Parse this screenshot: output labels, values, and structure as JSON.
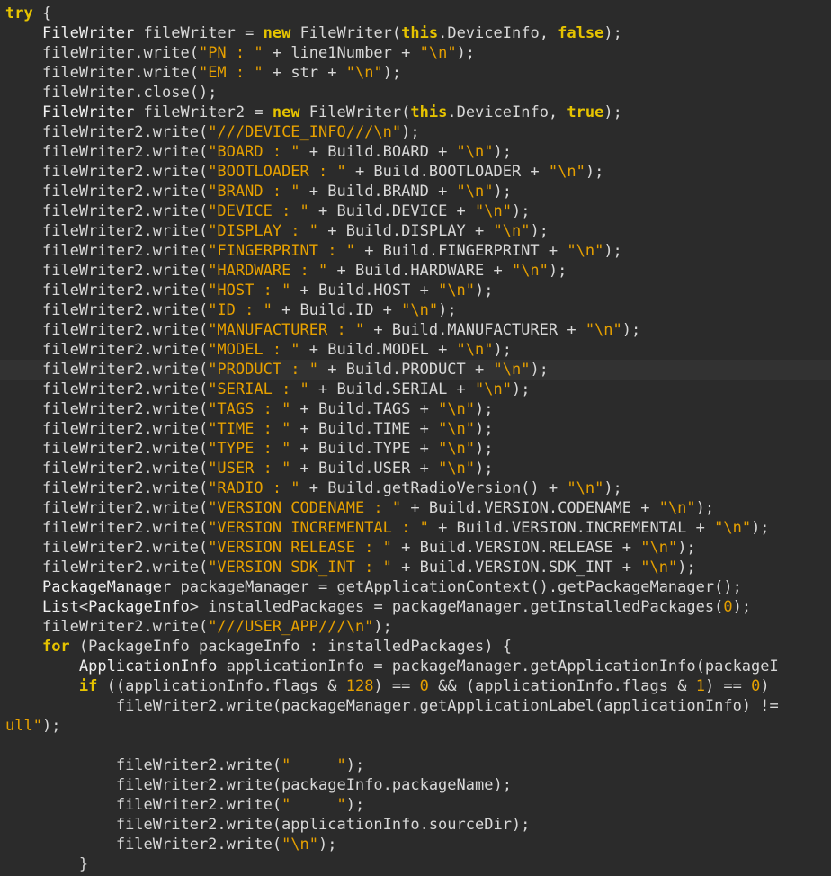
{
  "editor": {
    "language": "java",
    "colors": {
      "background": "#2b2b2b",
      "keyword": "#e6c300",
      "string": "#e6a000",
      "text": "#d8d8d8",
      "current_line": "#323232"
    },
    "current_line_index": 18,
    "lines": [
      {
        "indent": "",
        "tokens": [
          [
            "kw",
            "try"
          ],
          [
            "plain",
            " {"
          ]
        ]
      },
      {
        "indent": "    ",
        "tokens": [
          [
            "type",
            "FileWriter"
          ],
          [
            "plain",
            " fileWriter = "
          ],
          [
            "kw",
            "new"
          ],
          [
            "plain",
            " FileWriter("
          ],
          [
            "this",
            "this"
          ],
          [
            "plain",
            ".DeviceInfo, "
          ],
          [
            "kw",
            "false"
          ],
          [
            "plain",
            ");"
          ]
        ]
      },
      {
        "indent": "    ",
        "tokens": [
          [
            "plain",
            "fileWriter.write("
          ],
          [
            "str",
            "\"PN : \""
          ],
          [
            "plain",
            " + line1Number + "
          ],
          [
            "str",
            "\"\\n\""
          ],
          [
            "plain",
            ");"
          ]
        ]
      },
      {
        "indent": "    ",
        "tokens": [
          [
            "plain",
            "fileWriter.write("
          ],
          [
            "str",
            "\"EM : \""
          ],
          [
            "plain",
            " + str + "
          ],
          [
            "str",
            "\"\\n\""
          ],
          [
            "plain",
            ");"
          ]
        ]
      },
      {
        "indent": "    ",
        "tokens": [
          [
            "plain",
            "fileWriter.close();"
          ]
        ]
      },
      {
        "indent": "    ",
        "tokens": [
          [
            "type",
            "FileWriter"
          ],
          [
            "plain",
            " fileWriter2 = "
          ],
          [
            "kw",
            "new"
          ],
          [
            "plain",
            " FileWriter("
          ],
          [
            "this",
            "this"
          ],
          [
            "plain",
            ".DeviceInfo, "
          ],
          [
            "kw",
            "true"
          ],
          [
            "plain",
            ");"
          ]
        ]
      },
      {
        "indent": "    ",
        "tokens": [
          [
            "plain",
            "fileWriter2.write("
          ],
          [
            "str",
            "\"///DEVICE_INFO///\\n\""
          ],
          [
            "plain",
            ");"
          ]
        ]
      },
      {
        "indent": "    ",
        "tokens": [
          [
            "plain",
            "fileWriter2.write("
          ],
          [
            "str",
            "\"BOARD : \""
          ],
          [
            "plain",
            " + Build.BOARD + "
          ],
          [
            "str",
            "\"\\n\""
          ],
          [
            "plain",
            ");"
          ]
        ]
      },
      {
        "indent": "    ",
        "tokens": [
          [
            "plain",
            "fileWriter2.write("
          ],
          [
            "str",
            "\"BOOTLOADER : \""
          ],
          [
            "plain",
            " + Build.BOOTLOADER + "
          ],
          [
            "str",
            "\"\\n\""
          ],
          [
            "plain",
            ");"
          ]
        ]
      },
      {
        "indent": "    ",
        "tokens": [
          [
            "plain",
            "fileWriter2.write("
          ],
          [
            "str",
            "\"BRAND : \""
          ],
          [
            "plain",
            " + Build.BRAND + "
          ],
          [
            "str",
            "\"\\n\""
          ],
          [
            "plain",
            ");"
          ]
        ]
      },
      {
        "indent": "    ",
        "tokens": [
          [
            "plain",
            "fileWriter2.write("
          ],
          [
            "str",
            "\"DEVICE : \""
          ],
          [
            "plain",
            " + Build.DEVICE + "
          ],
          [
            "str",
            "\"\\n\""
          ],
          [
            "plain",
            ");"
          ]
        ]
      },
      {
        "indent": "    ",
        "tokens": [
          [
            "plain",
            "fileWriter2.write("
          ],
          [
            "str",
            "\"DISPLAY : \""
          ],
          [
            "plain",
            " + Build.DISPLAY + "
          ],
          [
            "str",
            "\"\\n\""
          ],
          [
            "plain",
            ");"
          ]
        ]
      },
      {
        "indent": "    ",
        "tokens": [
          [
            "plain",
            "fileWriter2.write("
          ],
          [
            "str",
            "\"FINGERPRINT : \""
          ],
          [
            "plain",
            " + Build.FINGERPRINT + "
          ],
          [
            "str",
            "\"\\n\""
          ],
          [
            "plain",
            ");"
          ]
        ]
      },
      {
        "indent": "    ",
        "tokens": [
          [
            "plain",
            "fileWriter2.write("
          ],
          [
            "str",
            "\"HARDWARE : \""
          ],
          [
            "plain",
            " + Build.HARDWARE + "
          ],
          [
            "str",
            "\"\\n\""
          ],
          [
            "plain",
            ");"
          ]
        ]
      },
      {
        "indent": "    ",
        "tokens": [
          [
            "plain",
            "fileWriter2.write("
          ],
          [
            "str",
            "\"HOST : \""
          ],
          [
            "plain",
            " + Build.HOST + "
          ],
          [
            "str",
            "\"\\n\""
          ],
          [
            "plain",
            ");"
          ]
        ]
      },
      {
        "indent": "    ",
        "tokens": [
          [
            "plain",
            "fileWriter2.write("
          ],
          [
            "str",
            "\"ID : \""
          ],
          [
            "plain",
            " + Build.ID + "
          ],
          [
            "str",
            "\"\\n\""
          ],
          [
            "plain",
            ");"
          ]
        ]
      },
      {
        "indent": "    ",
        "tokens": [
          [
            "plain",
            "fileWriter2.write("
          ],
          [
            "str",
            "\"MANUFACTURER : \""
          ],
          [
            "plain",
            " + Build.MANUFACTURER + "
          ],
          [
            "str",
            "\"\\n\""
          ],
          [
            "plain",
            ");"
          ]
        ]
      },
      {
        "indent": "    ",
        "tokens": [
          [
            "plain",
            "fileWriter2.write("
          ],
          [
            "str",
            "\"MODEL : \""
          ],
          [
            "plain",
            " + Build.MODEL + "
          ],
          [
            "str",
            "\"\\n\""
          ],
          [
            "plain",
            ");"
          ]
        ]
      },
      {
        "indent": "    ",
        "tokens": [
          [
            "plain",
            "fileWriter2.write("
          ],
          [
            "str",
            "\"PRODUCT : \""
          ],
          [
            "plain",
            " + Build.PRODUCT + "
          ],
          [
            "str",
            "\"\\n\""
          ],
          [
            "plain",
            ");"
          ]
        ]
      },
      {
        "indent": "    ",
        "tokens": [
          [
            "plain",
            "fileWriter2.write("
          ],
          [
            "str",
            "\"SERIAL : \""
          ],
          [
            "plain",
            " + Build.SERIAL + "
          ],
          [
            "str",
            "\"\\n\""
          ],
          [
            "plain",
            ");"
          ]
        ]
      },
      {
        "indent": "    ",
        "tokens": [
          [
            "plain",
            "fileWriter2.write("
          ],
          [
            "str",
            "\"TAGS : \""
          ],
          [
            "plain",
            " + Build.TAGS + "
          ],
          [
            "str",
            "\"\\n\""
          ],
          [
            "plain",
            ");"
          ]
        ]
      },
      {
        "indent": "    ",
        "tokens": [
          [
            "plain",
            "fileWriter2.write("
          ],
          [
            "str",
            "\"TIME : \""
          ],
          [
            "plain",
            " + Build.TIME + "
          ],
          [
            "str",
            "\"\\n\""
          ],
          [
            "plain",
            ");"
          ]
        ]
      },
      {
        "indent": "    ",
        "tokens": [
          [
            "plain",
            "fileWriter2.write("
          ],
          [
            "str",
            "\"TYPE : \""
          ],
          [
            "plain",
            " + Build.TYPE + "
          ],
          [
            "str",
            "\"\\n\""
          ],
          [
            "plain",
            ");"
          ]
        ]
      },
      {
        "indent": "    ",
        "tokens": [
          [
            "plain",
            "fileWriter2.write("
          ],
          [
            "str",
            "\"USER : \""
          ],
          [
            "plain",
            " + Build.USER + "
          ],
          [
            "str",
            "\"\\n\""
          ],
          [
            "plain",
            ");"
          ]
        ]
      },
      {
        "indent": "    ",
        "tokens": [
          [
            "plain",
            "fileWriter2.write("
          ],
          [
            "str",
            "\"RADIO : \""
          ],
          [
            "plain",
            " + Build.getRadioVersion() + "
          ],
          [
            "str",
            "\"\\n\""
          ],
          [
            "plain",
            ");"
          ]
        ]
      },
      {
        "indent": "    ",
        "tokens": [
          [
            "plain",
            "fileWriter2.write("
          ],
          [
            "str",
            "\"VERSION CODENAME : \""
          ],
          [
            "plain",
            " + Build.VERSION.CODENAME + "
          ],
          [
            "str",
            "\"\\n\""
          ],
          [
            "plain",
            ");"
          ]
        ]
      },
      {
        "indent": "    ",
        "tokens": [
          [
            "plain",
            "fileWriter2.write("
          ],
          [
            "str",
            "\"VERSION INCREMENTAL : \""
          ],
          [
            "plain",
            " + Build.VERSION.INCREMENTAL + "
          ],
          [
            "str",
            "\"\\n\""
          ],
          [
            "plain",
            ");"
          ]
        ]
      },
      {
        "indent": "    ",
        "tokens": [
          [
            "plain",
            "fileWriter2.write("
          ],
          [
            "str",
            "\"VERSION RELEASE : \""
          ],
          [
            "plain",
            " + Build.VERSION.RELEASE + "
          ],
          [
            "str",
            "\"\\n\""
          ],
          [
            "plain",
            ");"
          ]
        ]
      },
      {
        "indent": "    ",
        "tokens": [
          [
            "plain",
            "fileWriter2.write("
          ],
          [
            "str",
            "\"VERSION SDK_INT : \""
          ],
          [
            "plain",
            " + Build.VERSION.SDK_INT + "
          ],
          [
            "str",
            "\"\\n\""
          ],
          [
            "plain",
            ");"
          ]
        ]
      },
      {
        "indent": "    ",
        "tokens": [
          [
            "type",
            "PackageManager"
          ],
          [
            "plain",
            " packageManager = getApplicationContext().getPackageManager();"
          ]
        ]
      },
      {
        "indent": "    ",
        "tokens": [
          [
            "type",
            "List"
          ],
          [
            "plain",
            "<"
          ],
          [
            "type",
            "PackageInfo"
          ],
          [
            "plain",
            "> installedPackages = packageManager.getInstalledPackages("
          ],
          [
            "num",
            "0"
          ],
          [
            "plain",
            ");"
          ]
        ]
      },
      {
        "indent": "    ",
        "tokens": [
          [
            "plain",
            "fileWriter2.write("
          ],
          [
            "str",
            "\"///USER_APP///\\n\""
          ],
          [
            "plain",
            ");"
          ]
        ]
      },
      {
        "indent": "    ",
        "tokens": [
          [
            "kw",
            "for"
          ],
          [
            "plain",
            " (PackageInfo packageInfo : installedPackages) {"
          ]
        ]
      },
      {
        "indent": "        ",
        "tokens": [
          [
            "type",
            "ApplicationInfo"
          ],
          [
            "plain",
            " applicationInfo = packageManager.getApplicationInfo(packageI"
          ]
        ]
      },
      {
        "indent": "        ",
        "tokens": [
          [
            "kw",
            "if"
          ],
          [
            "plain",
            " ((applicationInfo.flags & "
          ],
          [
            "num",
            "128"
          ],
          [
            "plain",
            ") == "
          ],
          [
            "num",
            "0"
          ],
          [
            "plain",
            " && (applicationInfo.flags & "
          ],
          [
            "num",
            "1"
          ],
          [
            "plain",
            ") == "
          ],
          [
            "num",
            "0"
          ],
          [
            "plain",
            ")"
          ]
        ]
      },
      {
        "indent": "            ",
        "tokens": [
          [
            "plain",
            "fileWriter2.write(packageManager.getApplicationLabel(applicationInfo) !="
          ]
        ]
      },
      {
        "indent": "",
        "tokens": [
          [
            "str",
            "ull\""
          ],
          [
            "plain",
            ");"
          ]
        ]
      },
      {
        "indent": "",
        "tokens": []
      },
      {
        "indent": "            ",
        "tokens": [
          [
            "plain",
            "fileWriter2.write("
          ],
          [
            "str",
            "\"     \""
          ],
          [
            "plain",
            ");"
          ]
        ]
      },
      {
        "indent": "            ",
        "tokens": [
          [
            "plain",
            "fileWriter2.write(packageInfo.packageName);"
          ]
        ]
      },
      {
        "indent": "            ",
        "tokens": [
          [
            "plain",
            "fileWriter2.write("
          ],
          [
            "str",
            "\"     \""
          ],
          [
            "plain",
            ");"
          ]
        ]
      },
      {
        "indent": "            ",
        "tokens": [
          [
            "plain",
            "fileWriter2.write(applicationInfo.sourceDir);"
          ]
        ]
      },
      {
        "indent": "            ",
        "tokens": [
          [
            "plain",
            "fileWriter2.write("
          ],
          [
            "str",
            "\"\\n\""
          ],
          [
            "plain",
            ");"
          ]
        ]
      },
      {
        "indent": "        ",
        "tokens": [
          [
            "plain",
            "}"
          ]
        ]
      },
      {
        "indent": "    ",
        "tokens": [
          [
            "plain",
            "}"
          ]
        ]
      }
    ]
  }
}
